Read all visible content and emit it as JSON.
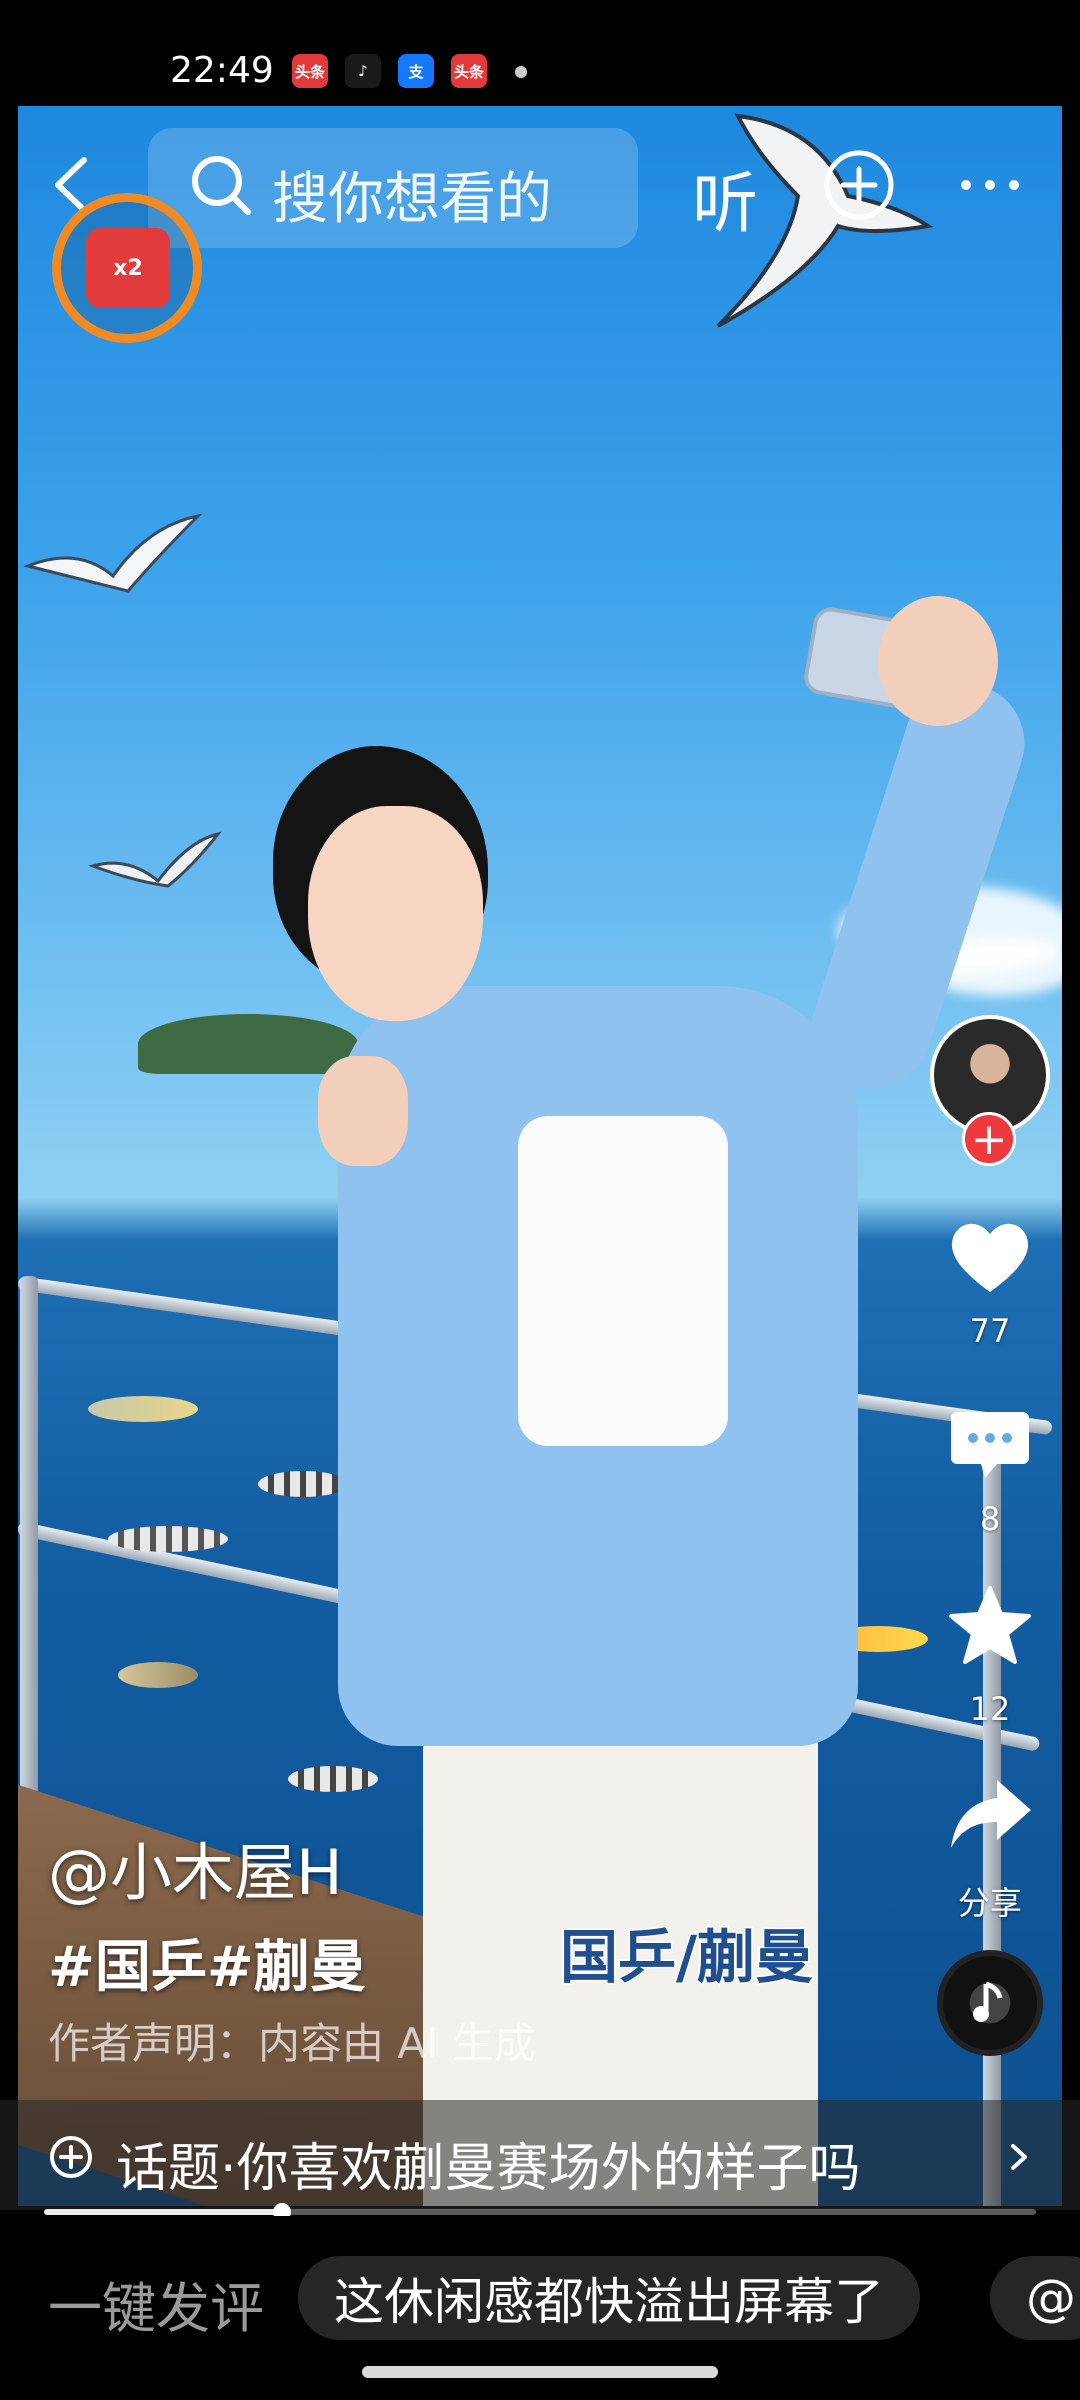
{
  "status_bar": {
    "time": "22:49",
    "apps": [
      {
        "label": "头条",
        "color": "#e3393b"
      },
      {
        "label": "♪",
        "color": "#1a1a1a"
      },
      {
        "label": "支",
        "color": "#1677ff"
      },
      {
        "label": "头条",
        "color": "#e3393b"
      }
    ]
  },
  "top_bar": {
    "search_placeholder": "搜你想看的",
    "listen_label": "听"
  },
  "reward": {
    "badge": "x2"
  },
  "actions": {
    "like_count": "77",
    "comment_count": "8",
    "favorite_count": "12",
    "share_label": "分享"
  },
  "video_info": {
    "author": "@小木屋H",
    "hashtags": "#国乒#蒯曼",
    "declaration": "作者声明：内容由 AI 生成",
    "caption": "国乒/蒯曼"
  },
  "topic": {
    "text": "话题·你喜欢蒯曼赛场外的样子吗"
  },
  "progress": {
    "fraction": 0.24
  },
  "comment_bar": {
    "label": "一键发评",
    "quick_comments": [
      "这休闲感都快溢出屏幕了",
      "@"
    ]
  },
  "colors": {
    "accent_red": "#f0393d",
    "reward_ring": "#f08a22"
  }
}
